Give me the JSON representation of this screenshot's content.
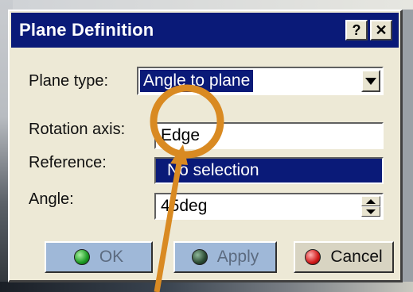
{
  "dialog": {
    "title": "Plane Definition",
    "help_button": "?",
    "close_button": "✕"
  },
  "form": {
    "plane_type_label": "Plane type:",
    "plane_type_value": "Angle to plane",
    "rotation_axis_label": "Rotation axis:",
    "rotation_axis_value": "Edge",
    "reference_label": "Reference:",
    "reference_value": "No selection",
    "angle_label": "Angle:",
    "angle_value": "45deg"
  },
  "buttons": {
    "ok": "OK",
    "apply": "Apply",
    "cancel": "Cancel"
  },
  "annotation": {
    "highlight_color": "#d98a22"
  },
  "colors": {
    "titlebar": "#0a1a78",
    "dialog_bg": "#ede9d6",
    "selection": "#0a1a78"
  }
}
